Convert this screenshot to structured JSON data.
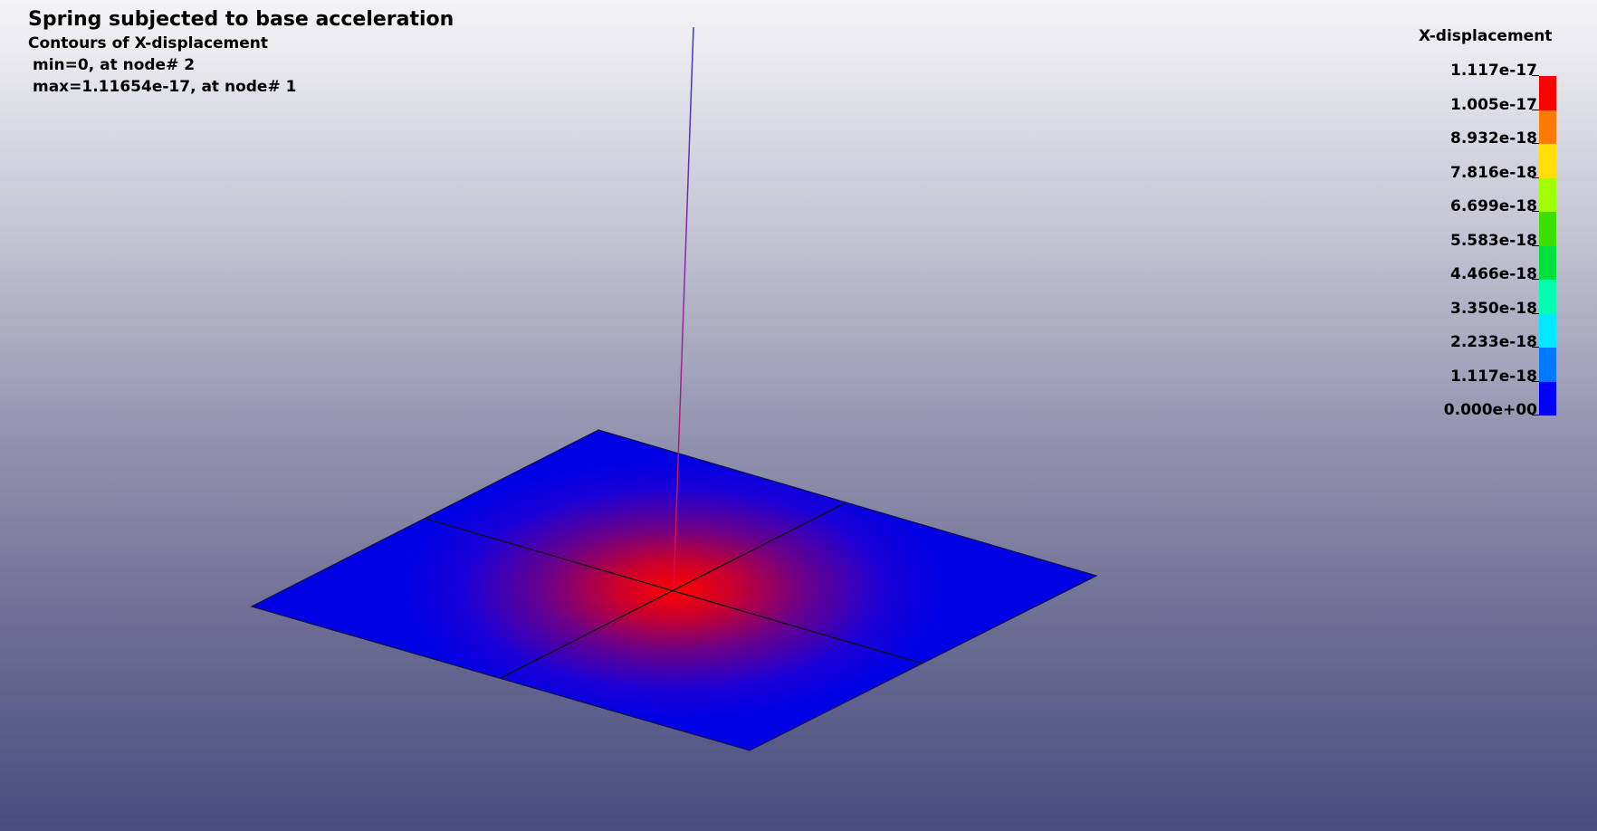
{
  "header": {
    "title": "Spring subjected to base acceleration",
    "subtitle": "Contours of X-displacement",
    "min_line": "min=0, at node# 2",
    "max_line": "max=1.11654e-17, at node# 1"
  },
  "legend": {
    "title": "X-displacement",
    "labels": [
      "1.117e-17",
      "1.005e-17",
      "8.932e-18",
      "7.816e-18",
      "6.699e-18",
      "5.583e-18",
      "4.466e-18",
      "3.350e-18",
      "2.233e-18",
      "1.117e-18",
      "0.000e+00"
    ],
    "colors": [
      "#ff0000",
      "#ff7a00",
      "#ffe000",
      "#a0ff00",
      "#3ce000",
      "#00e03c",
      "#00ffb0",
      "#00e8ff",
      "#0078ff",
      "#0000ff"
    ]
  },
  "scene": {
    "plate_color": "#0000e4",
    "hot_color": "#ff0000",
    "spring_top_color": "#3a36c8",
    "spring_bottom_color": "#e0083a"
  }
}
